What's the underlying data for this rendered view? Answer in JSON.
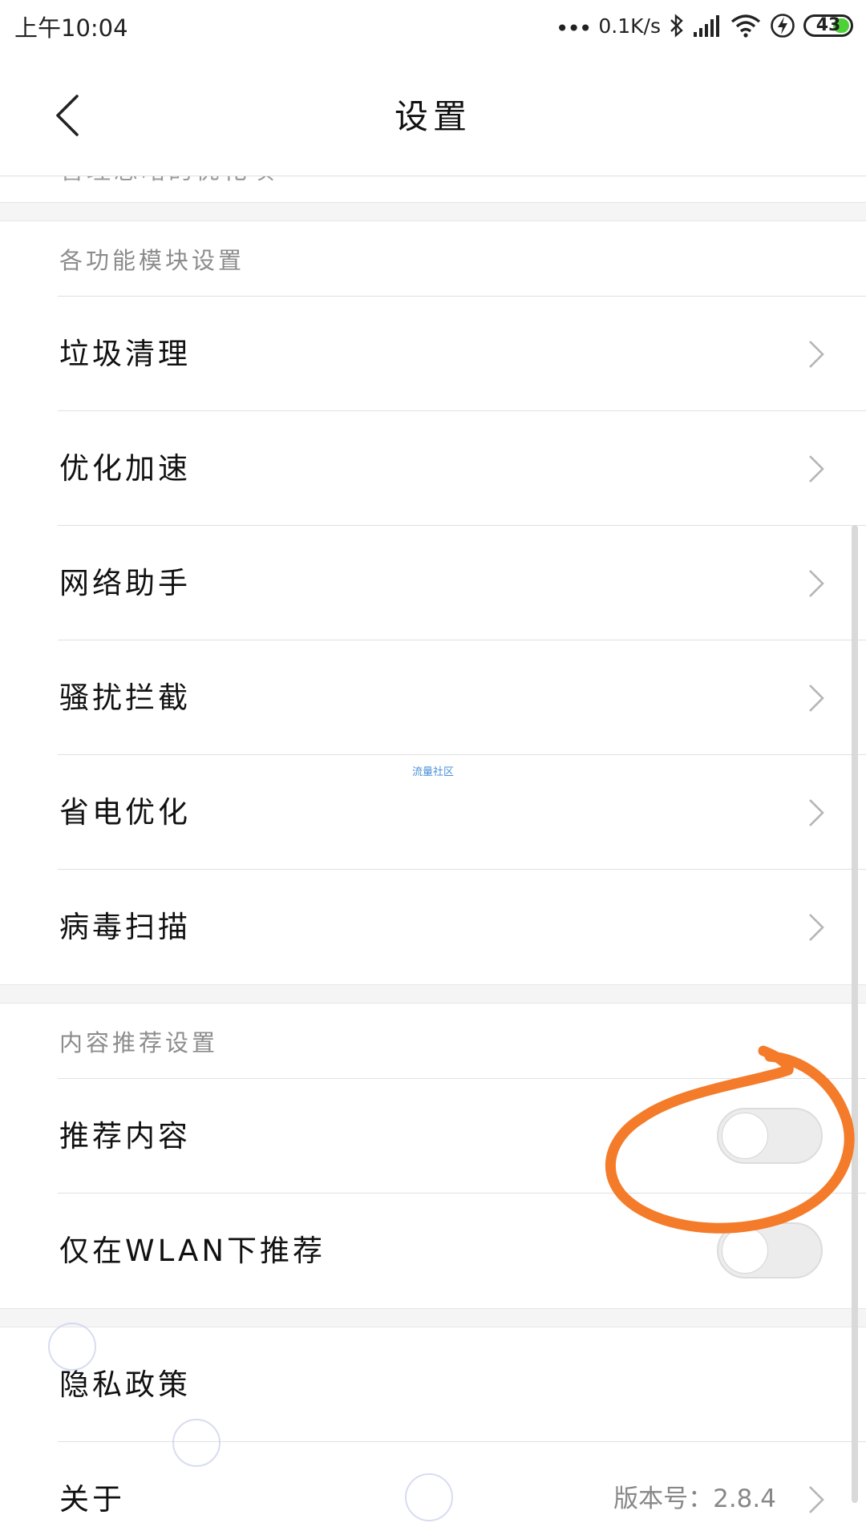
{
  "status_bar": {
    "time": "上午10:04",
    "dots": "•••",
    "net_speed": "0.1K/s",
    "battery_level": "43",
    "icons": [
      "bluetooth-icon",
      "signal-icon",
      "wifi-icon",
      "charging-icon",
      "battery-icon"
    ]
  },
  "header": {
    "title": "设置",
    "back_icon": "chevron-left-icon"
  },
  "list": {
    "partial_item": "管理忽略的优化项",
    "module_section": {
      "title": "各功能模块设置",
      "items": [
        {
          "label": "垃圾清理"
        },
        {
          "label": "优化加速"
        },
        {
          "label": "网络助手"
        },
        {
          "label": "骚扰拦截"
        },
        {
          "label": "省电优化"
        },
        {
          "label": "病毒扫描"
        }
      ]
    },
    "content_section": {
      "title": "内容推荐设置",
      "items": [
        {
          "label": "推荐内容",
          "enabled": false
        },
        {
          "label": "仅在WLAN下推荐",
          "enabled": false
        }
      ]
    },
    "other_items": [
      {
        "label": "隐私政策"
      },
      {
        "label": "关于",
        "value": "版本号：2.8.4"
      }
    ]
  },
  "watermark": "流量社区",
  "colors": {
    "annotation": "#f47b2a",
    "section_title": "#8c8c8c",
    "divider": "#e0e0e0",
    "toggle_off": "#ececec",
    "battery_fill": "#4cd137"
  }
}
